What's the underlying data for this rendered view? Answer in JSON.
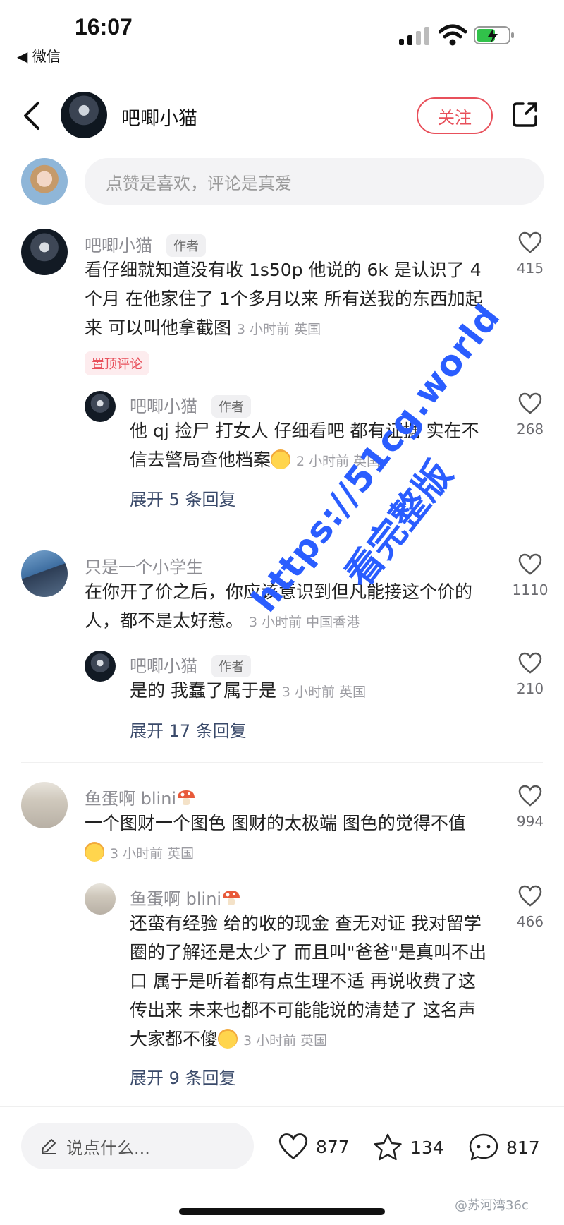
{
  "status_bar": {
    "time": "16:07",
    "back_app": "◀ 微信"
  },
  "header": {
    "title": "吧唧小猫",
    "follow_label": "关注"
  },
  "top_input": {
    "placeholder": "点赞是喜欢，评论是真爱"
  },
  "comments": [
    {
      "name": "吧唧小猫",
      "tag": "作者",
      "text": "看仔细就知道没有收 1s50p 他说的 6k 是认识了 4 个月 在他家住了 1个多月以来 所有送我的东西加起来 可以叫他拿截图",
      "meta": "3 小时前 英国",
      "pinned": "置顶评论",
      "likes": "415",
      "reply": {
        "name": "吧唧小猫",
        "tag": "作者",
        "text": "他 qj 捡尸 打女人 仔细看吧 都有证据 实在不信去警局查他档案",
        "meta": "2 小时前 英国",
        "likes": "268"
      },
      "expand": "展开 5 条回复"
    },
    {
      "name": "只是一个小学生",
      "text": "在你开了价之后，你应该意识到但凡能接这个价的人，都不是太好惹。",
      "meta": "3 小时前 中国香港",
      "likes": "1110",
      "reply": {
        "name": "吧唧小猫",
        "tag": "作者",
        "text": "是的 我蠢了属于是",
        "meta": "3 小时前 英国",
        "likes": "210"
      },
      "expand": "展开 17 条回复"
    },
    {
      "name": "鱼蛋啊 blini",
      "text": "一个图财一个图色 图财的太极端 图色的觉得不值",
      "meta": "3 小时前 英国",
      "likes": "994",
      "reply": {
        "name": "鱼蛋啊 blini",
        "text": "还蛮有经验 给的收的现金 查无对证 我对留学圈的了解还是太少了 而且叫\"爸爸\"是真叫不出口 属于是听着都有点生理不适 再说收费了这传出来 未来也都不可能能说的清楚了 这名声 大家都不傻",
        "meta": "3 小时前 英国",
        "likes": "466"
      },
      "expand": "展开 9 条回复"
    }
  ],
  "bottom_bar": {
    "placeholder": "说点什么...",
    "likes": "877",
    "favorites": "134",
    "comments": "817"
  },
  "watermark": {
    "line1": "https://51cg.world",
    "line2": "看完整版"
  },
  "weibo_mark": "@苏河湾36c",
  "colors": {
    "accent": "#e8505b",
    "watermark": "#2a5dff"
  }
}
